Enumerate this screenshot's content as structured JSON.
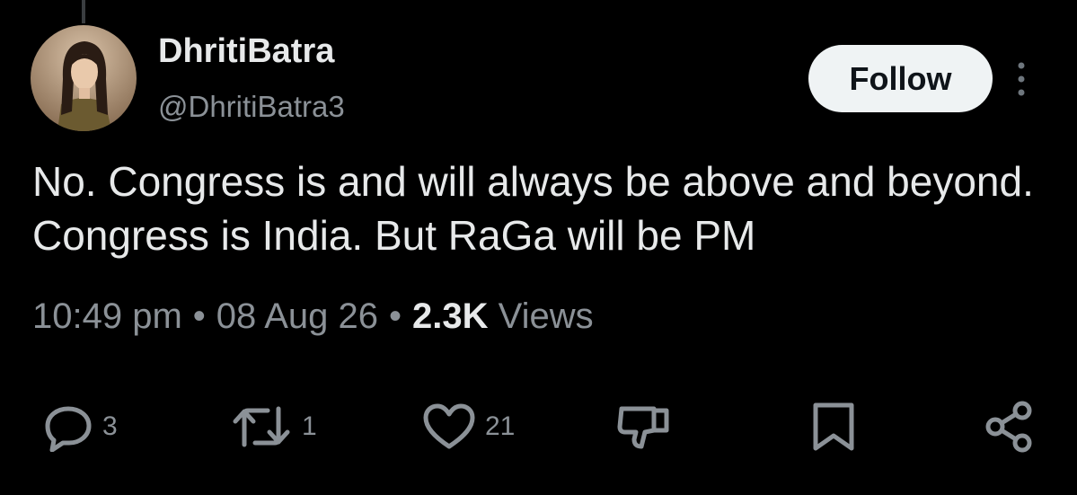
{
  "author": {
    "display_name": "DhritiBatra",
    "handle": "@DhritiBatra3"
  },
  "follow_button": {
    "label": "Follow"
  },
  "tweet": {
    "text": "No. Congress is and will always be above and beyond. Congress is India. But RaGa will be PM"
  },
  "meta": {
    "time": "10:49 pm",
    "separator": "•",
    "date": "08 Aug 26",
    "views_count": "2.3K",
    "views_label": "Views"
  },
  "actions": {
    "reply": {
      "icon": "reply-icon",
      "count": "3"
    },
    "repost": {
      "icon": "repost-icon",
      "count": "1"
    },
    "like": {
      "icon": "heart-icon",
      "count": "21"
    },
    "downvote": {
      "icon": "downvote-icon"
    },
    "bookmark": {
      "icon": "bookmark-icon"
    },
    "share": {
      "icon": "share-icon"
    }
  },
  "colors": {
    "background": "#000000",
    "primary_text": "#e7e9ea",
    "secondary_text": "#8b9197",
    "follow_bg": "#eff3f4"
  }
}
